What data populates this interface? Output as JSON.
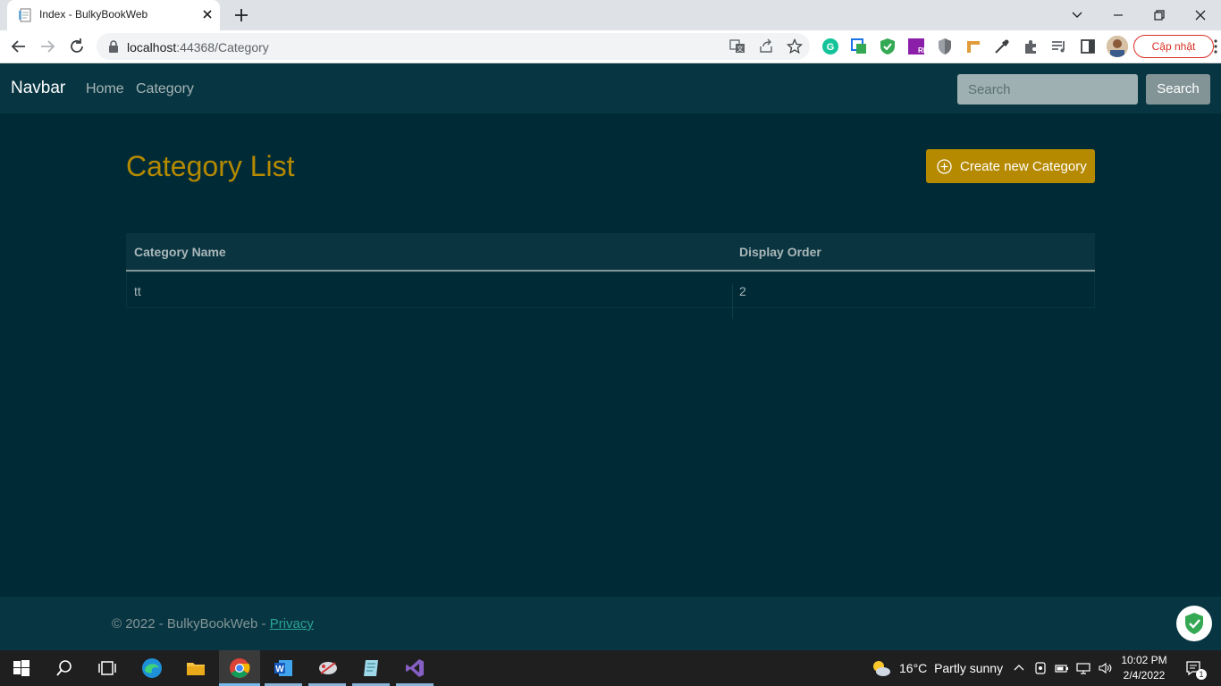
{
  "browser": {
    "tab_title": "Index - BulkyBookWeb",
    "url_host": "localhost",
    "url_rest": ":44368/Category",
    "update_label": "Cập nhật"
  },
  "navbar": {
    "brand": "Navbar",
    "links": [
      "Home",
      "Category"
    ],
    "search_placeholder": "Search",
    "search_button": "Search"
  },
  "main": {
    "title": "Category List",
    "create_button": "Create new Category",
    "table": {
      "headers": [
        "Category Name",
        "Display Order"
      ],
      "rows": [
        {
          "name": "tt",
          "order": "2"
        }
      ]
    }
  },
  "footer": {
    "copyright": "© 2022 - BulkyBookWeb - ",
    "privacy": "Privacy"
  },
  "taskbar": {
    "temperature": "16°C",
    "weather": "Partly sunny",
    "time": "10:02 PM",
    "date": "2/4/2022",
    "notification_count": "1"
  },
  "colors": {
    "page_bg": "#002b36",
    "navbar_bg": "#073642",
    "accent": "#b58900",
    "link": "#2aa198"
  }
}
